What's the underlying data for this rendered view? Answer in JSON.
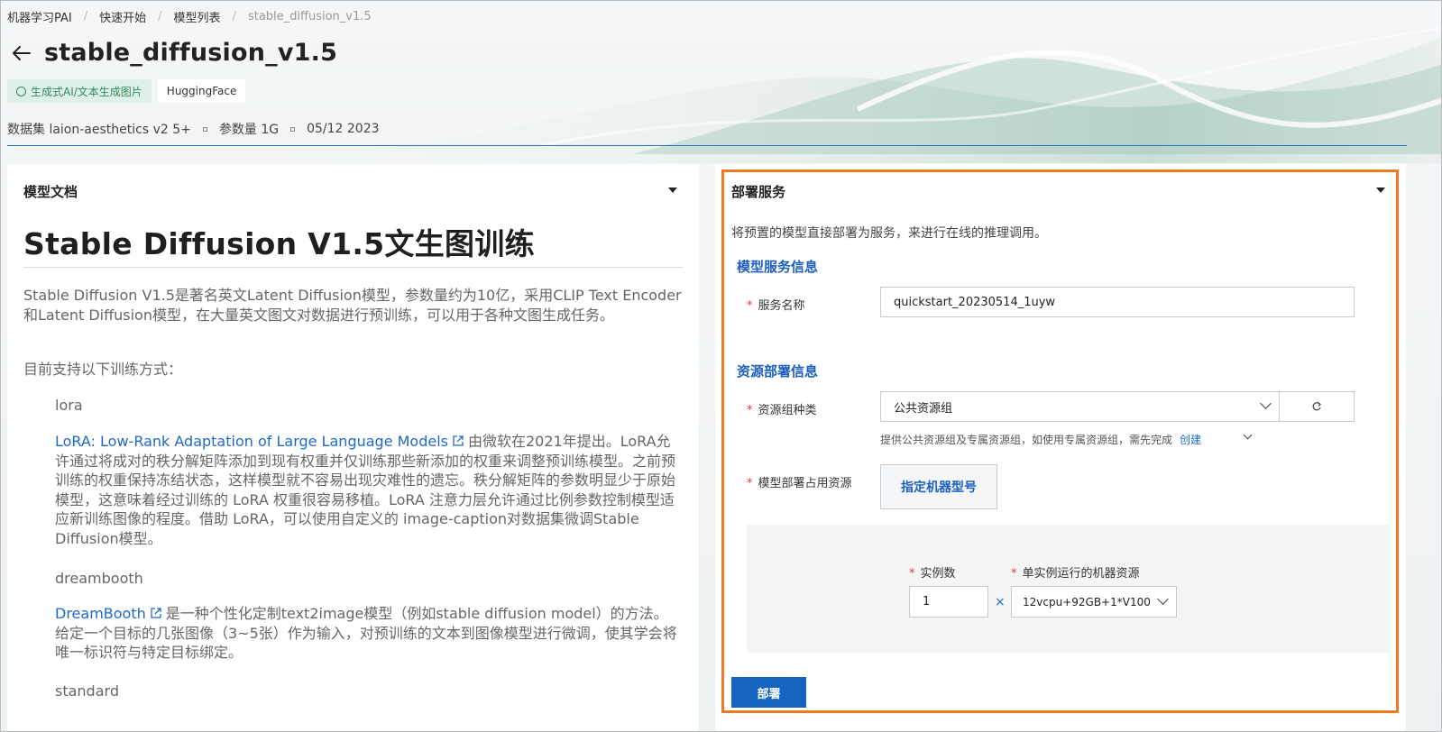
{
  "breadcrumb": [
    "机器学习PAI",
    "快速开始",
    "模型列表",
    "stable_diffusion_v1.5"
  ],
  "page_title": "stable_diffusion_v1.5",
  "tags": [
    "生成式AI/文本生成图片",
    "HuggingFace"
  ],
  "meta": {
    "dataset": "数据集 laion-aesthetics v2 5+",
    "params": "参数量 1G",
    "date": "05/12 2023"
  },
  "doc_panel": {
    "header": "模型文档",
    "title": "Stable Diffusion V1.5文生图训练",
    "intro": "Stable Diffusion V1.5是著名英文Latent Diffusion模型，参数量约为10亿，采用CLIP Text Encoder和Latent Diffusion模型，在大量英文图文对数据进行预训练，可以用于各种文图生成任务。",
    "support": "目前支持以下训练方式：",
    "lora_heading": "lora",
    "lora_link": "LoRA: Low-Rank Adaptation of Large Language Models",
    "lora_text": "由微软在2021年提出。LoRA允许通过将成对的秩分解矩阵添加到现有权重并仅训练那些新添加的权重来调整预训练模型。之前预训练的权重保持冻结状态，这样模型就不容易出现灾难性的遗忘。秩分解矩阵的参数明显少于原始模型，这意味着经过训练的 LoRA 权重很容易移植。LoRA 注意力层允许通过比例参数控制模型适应新训练图像的程度。借助 LoRA，可以使用自定义的 image-caption对数据集微调Stable Diffusion模型。",
    "dreambooth_heading": "dreambooth",
    "dreambooth_link": "DreamBooth",
    "dreambooth_text": "是一种个性化定制text2image模型（例如stable diffusion model）的方法。给定一个目标的几张图像（3~5张）作为输入，对预训练的文本到图像模型进行微调，使其学会将唯一标识符与特定目标绑定。",
    "standard_heading": "standard"
  },
  "deploy_panel": {
    "header": "部署服务",
    "intro": "将预置的模型直接部署为服务，来进行在线的推理调用。",
    "service_info_title": "模型服务信息",
    "service_name_label": "服务名称",
    "service_name_value": "quickstart_20230514_1uyw",
    "resource_info_title": "资源部署信息",
    "resource_group_label": "资源组种类",
    "resource_group_value": "公共资源组",
    "resource_hint": "提供公共资源组及专属资源组，如使用专属资源组，需先完成",
    "create_link": "创建",
    "resource_usage_label": "模型部署占用资源",
    "spec_button": "指定机器型号",
    "instance_label": "实例数",
    "instance_value": "1",
    "times_symbol": "×",
    "machine_label": "单实例运行的机器资源",
    "machine_value": "12vcpu+92GB+1*V100",
    "required_mark": "*",
    "deploy_button": "部署"
  },
  "colors": {
    "primary": "#1565c0",
    "highlight": "#f07a21",
    "link": "#1e6bc6",
    "tag_green": "#2f8a5b"
  }
}
